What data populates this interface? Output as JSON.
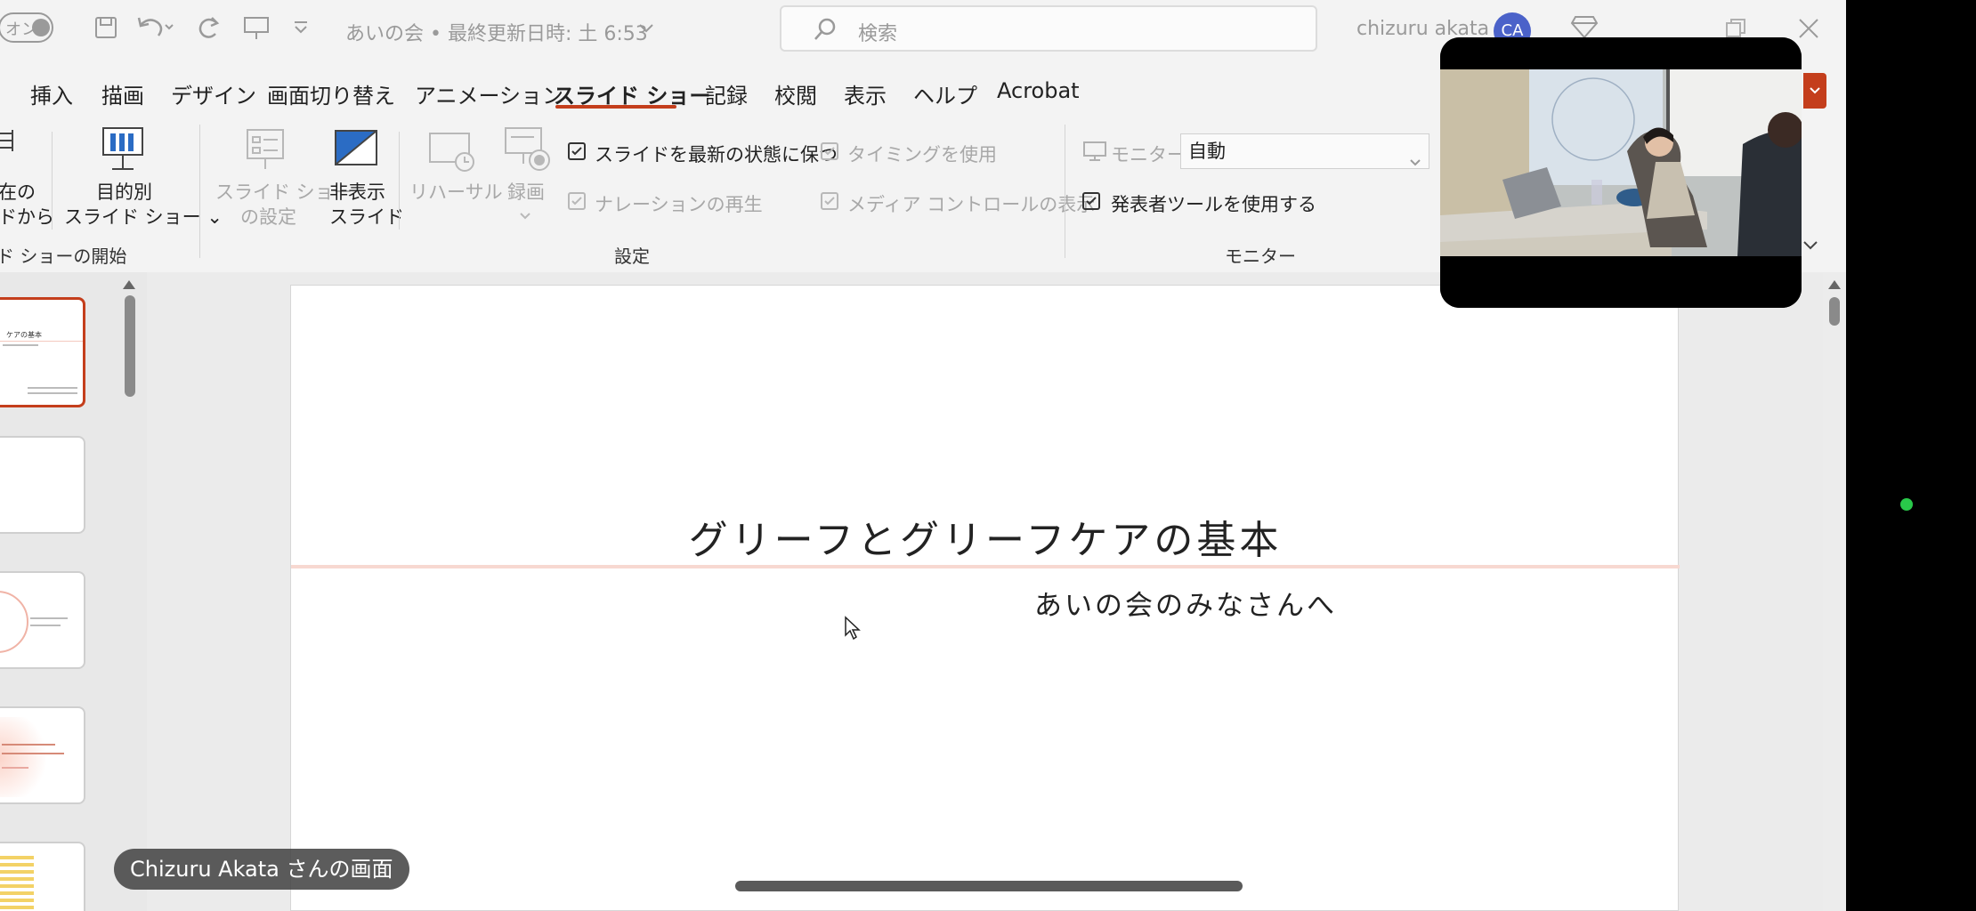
{
  "titlebar": {
    "autosave_toggle": "オン",
    "doc_title": "あいの会 • 最終更新日時: 土 6:53",
    "search_placeholder": "検索",
    "user_name": "chizuru akata",
    "avatar_initials": "CA"
  },
  "tabs": [
    {
      "label": "挿入"
    },
    {
      "label": "描画"
    },
    {
      "label": "デザイン"
    },
    {
      "label": "画面切り替え"
    },
    {
      "label": "アニメーション"
    },
    {
      "label": "スライド ショー",
      "active": true
    },
    {
      "label": "記録"
    },
    {
      "label": "校閲"
    },
    {
      "label": "表示"
    },
    {
      "label": "ヘルプ"
    },
    {
      "label": "Acrobat"
    }
  ],
  "ribbon": {
    "from_current": [
      "在の",
      "ドから"
    ],
    "custom_show": [
      "目的別",
      "スライド ショー ⌄"
    ],
    "start_group": "ド ショーの開始",
    "setup_show": [
      "スライド ショー",
      "の設定"
    ],
    "hide_slide": [
      "非表示",
      "スライド"
    ],
    "rehearse": "リハーサル",
    "record": "録画",
    "keep_updated": "スライドを最新の状態に保つ",
    "use_timings": "タイミングを使用",
    "play_narration": "ナレーションの再生",
    "show_media_controls": "メディア コントロールの表示",
    "setup_group": "設定",
    "monitor_label": "モニター:",
    "monitor_value": "自動",
    "presenter_view": "発表者ツールを使用する",
    "monitor_group": "モニター"
  },
  "slide": {
    "title": "グリーフとグリーフケアの基本",
    "subtitle": "あいの会のみなさんへ"
  },
  "thumbnails": {
    "t1_title": "ケアの基本"
  },
  "share_label": "Chizuru Akata さんの画面",
  "colors": {
    "accent": "#c43e1c",
    "avatar": "#4b62c9",
    "status_dot": "#29c94a"
  }
}
